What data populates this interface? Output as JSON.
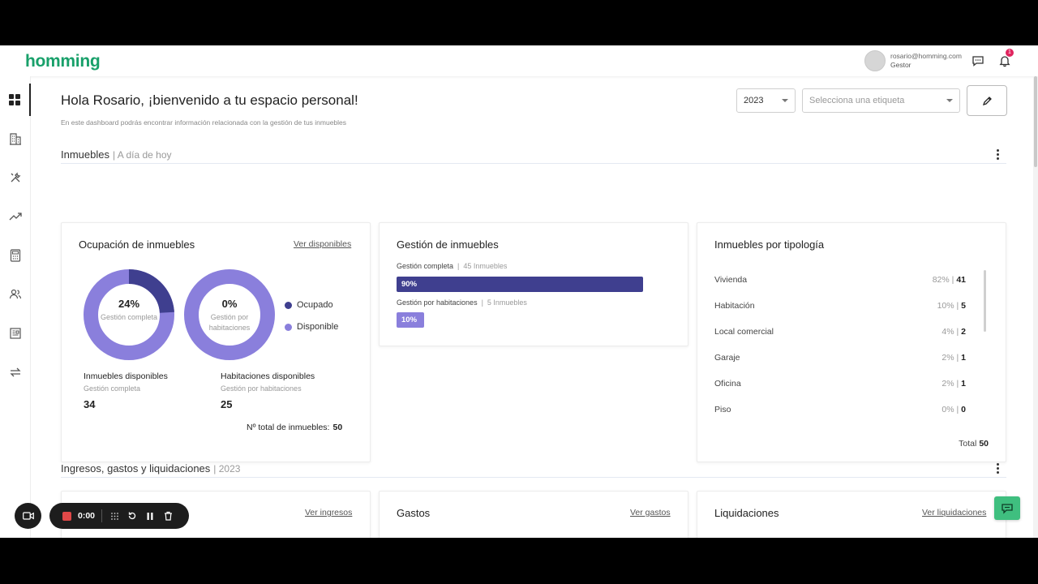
{
  "header": {
    "logo": "homming",
    "user_email": "rosario@homming.com",
    "user_role": "Gestor",
    "notification_count": "1"
  },
  "sidebar": {
    "items": [
      {
        "icon": "dashboard-icon",
        "active": true
      },
      {
        "icon": "building-icon",
        "active": false
      },
      {
        "icon": "tools-icon",
        "active": false
      },
      {
        "icon": "trending-icon",
        "active": false
      },
      {
        "icon": "calculator-icon",
        "active": false
      },
      {
        "icon": "users-icon",
        "active": false
      },
      {
        "icon": "document-icon",
        "active": false
      },
      {
        "icon": "transfer-icon",
        "active": false
      }
    ]
  },
  "page": {
    "title": "Hola Rosario, ¡bienvenido a tu espacio personal!",
    "subtitle": "En este dashboard podrás encontrar información relacionada con la gestión de tus inmuebles",
    "year_select": "2023",
    "tag_select_placeholder": "Selecciona una etiqueta"
  },
  "inmuebles_section": {
    "title": "Inmuebles",
    "subtitle": "| A día de hoy"
  },
  "ocupacion": {
    "title": "Ocupación de inmuebles",
    "link": "Ver disponibles",
    "donut1": {
      "pct": "24%",
      "label": "Gestión completa",
      "fraction": 0.24
    },
    "donut2": {
      "pct": "0%",
      "label": "Gestión por habitaciones",
      "fraction": 0
    },
    "legend_occupied": "Ocupado",
    "legend_available": "Disponible",
    "stat1": {
      "title": "Inmuebles disponibles",
      "sub": "Gestión completa",
      "value": "34"
    },
    "stat2": {
      "title": "Habitaciones disponibles",
      "sub": "Gestión por habitaciones",
      "value": "25"
    },
    "total_label": "Nº total de inmuebles:",
    "total_value": "50"
  },
  "gestion": {
    "title": "Gestión de inmuebles",
    "bar1": {
      "label": "Gestión completa",
      "count": "45 Inmuebles",
      "pct": "90%",
      "fraction": 0.9
    },
    "bar2": {
      "label": "Gestión por habitaciones",
      "count": "5 Inmuebles",
      "pct": "10%",
      "fraction": 0.1
    }
  },
  "tipologia": {
    "title": "Inmuebles por tipología",
    "rows": [
      {
        "name": "Vivienda",
        "pct": "82% |",
        "count": "41"
      },
      {
        "name": "Habitación",
        "pct": "10% |",
        "count": "5"
      },
      {
        "name": "Local comercial",
        "pct": "4% |",
        "count": "2"
      },
      {
        "name": "Garaje",
        "pct": "2% |",
        "count": "1"
      },
      {
        "name": "Oficina",
        "pct": "2% |",
        "count": "1"
      },
      {
        "name": "Piso",
        "pct": "0% |",
        "count": "0"
      }
    ],
    "total_label": "Total",
    "total_value": "50"
  },
  "ingresos_section": {
    "title": "Ingresos, gastos y liquidaciones",
    "subtitle": "| 2023",
    "cards": [
      {
        "title": "",
        "link": "Ver ingresos"
      },
      {
        "title": "Gastos",
        "link": "Ver gastos"
      },
      {
        "title": "Liquidaciones",
        "link": "Ver liquidaciones"
      }
    ]
  },
  "recorder": {
    "time": "0:00"
  },
  "colors": {
    "brand": "#18a06a",
    "occupied": "#3f3f8f",
    "available": "#8a7fdc",
    "bar_dark": "#3f3f8f",
    "bar_light": "#8a7fdc"
  }
}
